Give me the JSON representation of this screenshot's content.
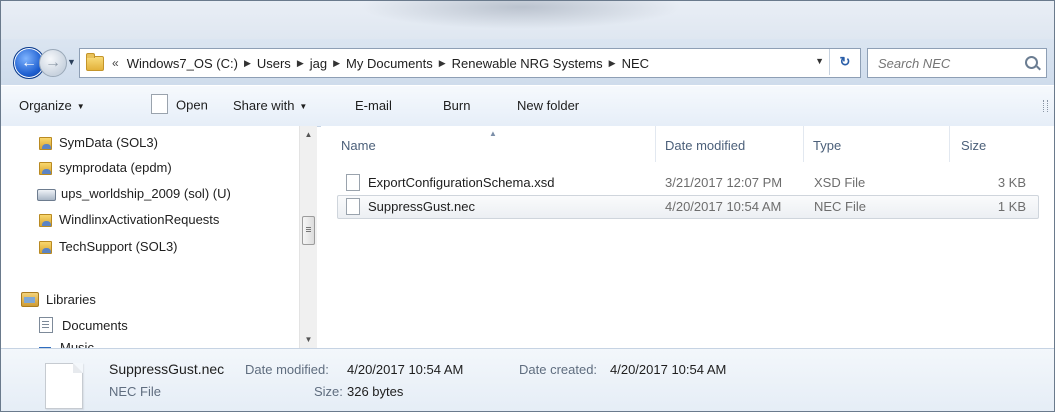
{
  "address": {
    "history_marker": "«",
    "crumbs": [
      "Windows7_OS (C:)",
      "Users",
      "jag",
      "My Documents",
      "Renewable NRG Systems",
      "NEC"
    ],
    "refresh_glyph": "↻"
  },
  "search": {
    "placeholder": "Search NEC"
  },
  "toolbar": {
    "organize": "Organize",
    "open": "Open",
    "share_with": "Share with",
    "email": "E-mail",
    "burn": "Burn",
    "new_folder": "New folder"
  },
  "nav_pane": {
    "items": [
      {
        "label": "SymData (SOL3)",
        "icon": "shared-folder-icon"
      },
      {
        "label": "symprodata (epdm)",
        "icon": "shared-folder-icon"
      },
      {
        "label": "ups_worldship_2009 (sol) (U)",
        "icon": "network-drive-icon"
      },
      {
        "label": "WindlinxActivationRequests",
        "icon": "shared-folder-icon"
      },
      {
        "label": "TechSupport (SOL3)",
        "icon": "shared-folder-icon"
      },
      {
        "label": "Libraries",
        "icon": "libraries-icon"
      },
      {
        "label": "Documents",
        "icon": "documents-icon"
      },
      {
        "label": "Music",
        "icon": "music-icon"
      }
    ]
  },
  "file_list": {
    "columns": [
      "Name",
      "Date modified",
      "Type",
      "Size"
    ],
    "rows": [
      {
        "name": "ExportConfigurationSchema.xsd",
        "date": "3/21/2017 12:07 PM",
        "type": "XSD File",
        "size": "3 KB",
        "selected": false
      },
      {
        "name": "SuppressGust.nec",
        "date": "4/20/2017 10:54 AM",
        "type": "NEC File",
        "size": "1 KB",
        "selected": true
      }
    ]
  },
  "details": {
    "name": "SuppressGust.nec",
    "type": "NEC File",
    "date_modified_label": "Date modified:",
    "date_modified": "4/20/2017 10:54 AM",
    "date_created_label": "Date created:",
    "date_created": "4/20/2017 10:54 AM",
    "size_label": "Size:",
    "size": "326 bytes"
  }
}
